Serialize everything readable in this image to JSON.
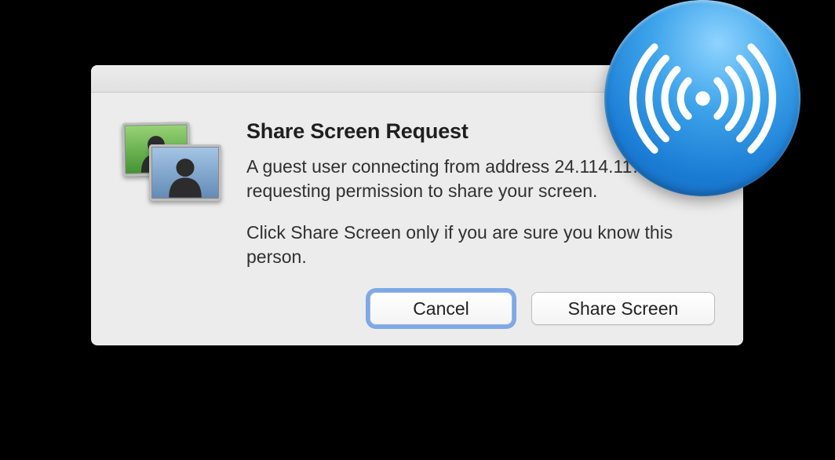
{
  "dialog": {
    "title": "Share Screen Request",
    "body": "A guest user connecting from address 24.114.11… requesting permission to share your screen.",
    "warning": "Click Share Screen only if you are sure you know this person.",
    "cancel_label": "Cancel",
    "share_label": "Share Screen"
  }
}
